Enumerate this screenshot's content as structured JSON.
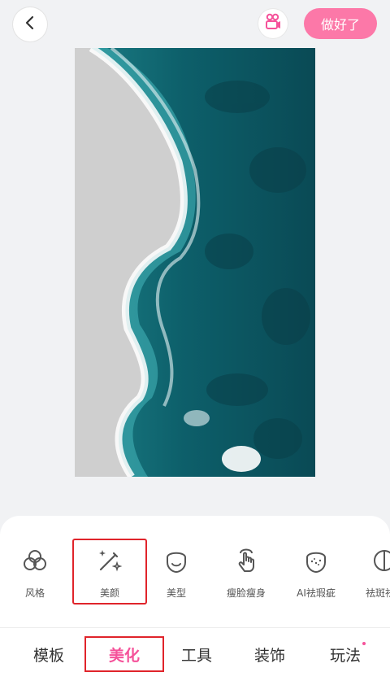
{
  "header": {
    "done_label": "做好了",
    "accent_color": "#fc78a8"
  },
  "photo": {
    "subject": "aerial beach with waves and turquoise sea"
  },
  "tools": [
    {
      "label": "风格",
      "icon": "style-circles-icon"
    },
    {
      "label": "美颜",
      "icon": "magic-wand-icon",
      "selected": true
    },
    {
      "label": "美型",
      "icon": "face-outline-icon"
    },
    {
      "label": "瘦脸瘦身",
      "icon": "hand-touch-icon"
    },
    {
      "label": "AI祛瑕疵",
      "icon": "face-dots-icon"
    },
    {
      "label": "祛斑祛",
      "icon": "half-face-icon"
    }
  ],
  "tabs": [
    {
      "label": "模板"
    },
    {
      "label": "美化",
      "active": true
    },
    {
      "label": "工具"
    },
    {
      "label": "装饰"
    },
    {
      "label": "玩法",
      "badge": true
    }
  ],
  "colors": {
    "active_tab": "#f5529a",
    "highlight_box": "#e0242b",
    "badge_dot": "#f5529a"
  }
}
